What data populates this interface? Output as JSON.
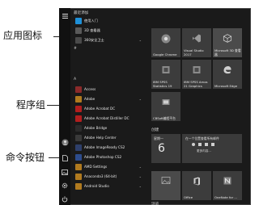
{
  "callouts": {
    "app_icon": "应用图标",
    "program_group": "程序组",
    "command_button": "命令按钮"
  },
  "menu": {
    "section_top": "最近添加",
    "recent": [
      {
        "label": "使用入门",
        "icon": "lightbulb-icon",
        "color": "#1e90d8"
      },
      {
        "label": "3D 查看器",
        "icon": "cube-icon",
        "color": "#5a5a5a"
      },
      {
        "label": "360安全卫士",
        "icon": "shield-icon",
        "color": "#4a4a4a"
      }
    ],
    "letter_hash": "#",
    "letter_a": "A",
    "apps": [
      {
        "label": "Access",
        "icon": "access-icon",
        "color": "#8b2a2a"
      },
      {
        "label": "Adobe",
        "icon": "folder-icon",
        "color": "#b07a1f"
      },
      {
        "label": "Adobe Acrobat DC",
        "icon": "acrobat-icon",
        "color": "#b21e1e"
      },
      {
        "label": "Adobe Acrobat Distiller DC",
        "icon": "acrobat-icon",
        "color": "#b21e1e"
      },
      {
        "label": "Adobe Bridge",
        "icon": "bridge-icon",
        "color": "#2b2b2b"
      },
      {
        "label": "Adobe Help Center",
        "icon": "help-icon",
        "color": "#3a3a3a"
      },
      {
        "label": "Adobe ImageReady CS2",
        "icon": "imageready-icon",
        "color": "#2e3f6a"
      },
      {
        "label": "Adobe Photoshop CS2",
        "icon": "photoshop-icon",
        "color": "#2d4c8c"
      },
      {
        "label": "AMD Settings",
        "icon": "folder-icon",
        "color": "#b07a1f"
      },
      {
        "label": "Anaconda3 (64-bit)",
        "icon": "folder-icon",
        "color": "#b07a1f"
      },
      {
        "label": "Android Studio",
        "icon": "folder-icon",
        "color": "#b07a1f"
      }
    ],
    "group_create": "创建",
    "group_browse": "浏览",
    "tiles": [
      {
        "label": "Google Chrome",
        "icon": "chrome-icon",
        "color": "#4a4a4a"
      },
      {
        "label": "Visual Studio 2017",
        "icon": "visual-studio-icon",
        "color": "#4a4a4a"
      },
      {
        "label": "Microsoft 3D 查看器",
        "icon": "cube-icon",
        "color": "#555555"
      },
      {
        "label": "IBM SPSS Statistics 19",
        "icon": "spss-icon",
        "color": "#3a3a3a"
      },
      {
        "label": "IBM SPSS Amos 21 Graphics",
        "icon": "spss-icon",
        "color": "#3a3a3a"
      },
      {
        "label": "Microsoft Edge",
        "icon": "edge-icon",
        "color": "#3a3a3a"
      },
      {
        "label": "CBSoft编程平台",
        "icon": "app-icon",
        "color": "#3a3a3a"
      }
    ],
    "calendar": {
      "weekday": "星期一",
      "day": "6"
    },
    "mail": {
      "text": "在一个位置查看所有邮件",
      "more": "更多内容..."
    },
    "create_tiles": [
      {
        "label": "",
        "icon": "photo-icon",
        "color": "#4a4a4a"
      },
      {
        "label": "Office",
        "icon": "office-icon",
        "color": "#3a3a3a"
      },
      {
        "label": "OneNote for ...",
        "icon": "onenote-icon",
        "color": "#3a3a3a"
      }
    ],
    "rail": [
      {
        "name": "user-icon"
      },
      {
        "name": "document-icon"
      },
      {
        "name": "pictures-icon"
      },
      {
        "name": "settings-icon"
      },
      {
        "name": "power-icon"
      }
    ]
  }
}
